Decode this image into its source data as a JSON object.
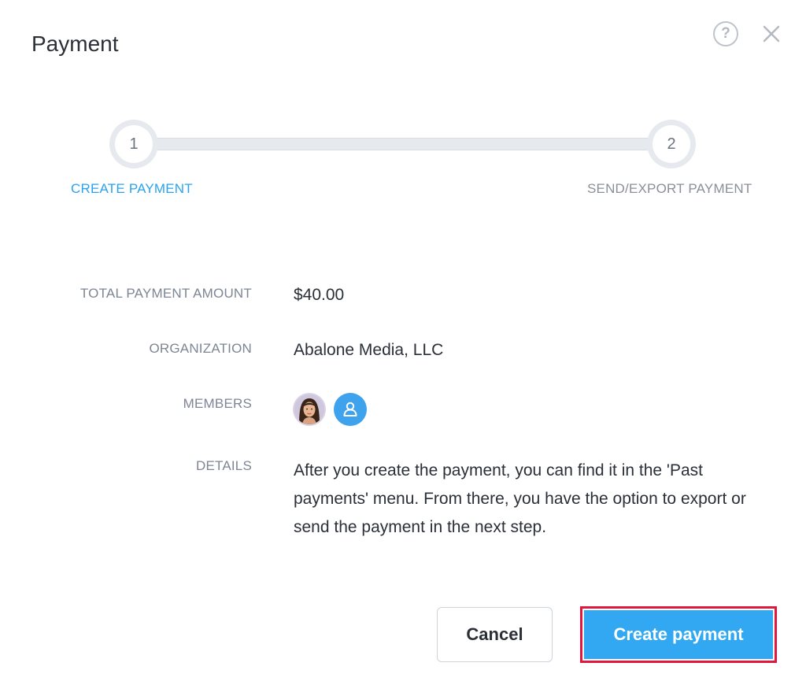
{
  "dialog": {
    "title": "Payment"
  },
  "header_icons": {
    "help": "help-icon",
    "close": "close-icon"
  },
  "stepper": {
    "steps": [
      {
        "number": "1",
        "label": "CREATE PAYMENT",
        "active": true
      },
      {
        "number": "2",
        "label": "SEND/EXPORT PAYMENT",
        "active": false
      }
    ],
    "active_color": "#2aa3ef"
  },
  "details": {
    "amount_label": "TOTAL PAYMENT AMOUNT",
    "amount_value": "$40.00",
    "organization_label": "ORGANIZATION",
    "organization_value": "Abalone Media, LLC",
    "members_label": "MEMBERS",
    "members": [
      {
        "type": "photo"
      },
      {
        "type": "placeholder-icon"
      }
    ],
    "details_label": "DETAILS",
    "details_text": "After you create the payment, you can find it in the 'Past payments' menu. From there, you have the option to export or send the payment in the next step."
  },
  "actions": {
    "cancel_label": "Cancel",
    "create_label": "Create payment",
    "primary_color": "#32a8f3",
    "highlight_color": "#e0173f"
  }
}
